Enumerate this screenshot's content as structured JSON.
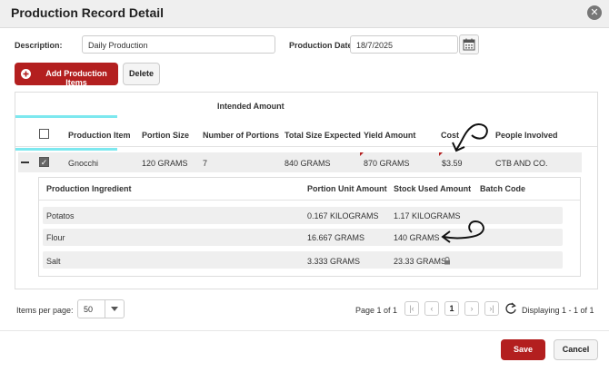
{
  "dialog": {
    "title": "Production Record Detail"
  },
  "form": {
    "description_label": "Description:",
    "description_value": "Daily Production",
    "date_label": "Production Date:",
    "date_value": "18/7/2025"
  },
  "toolbar": {
    "add_label": "Add Production Items",
    "delete_label": "Delete"
  },
  "grid": {
    "group_header": "Intended Amount",
    "columns": [
      "Production Item",
      "Portion Size",
      "Number of Portions",
      "Total Size Expected",
      "Yield Amount",
      "Cost",
      "People Involved"
    ],
    "row": {
      "item": "Gnocchi",
      "portion_size": "120 GRAMS",
      "portions": "7",
      "total_expected": "840 GRAMS",
      "yield": "870 GRAMS",
      "cost": "$3.59",
      "people": "CTB AND CO."
    },
    "sub_columns": [
      "Production Ingredient",
      "Portion Unit Amount",
      "Stock Used Amount",
      "Batch Code"
    ],
    "sub_rows": [
      {
        "ingredient": "Potatos",
        "unit_amount": "0.167 KILOGRAMS",
        "stock_used": "1.17 KILOGRAMS"
      },
      {
        "ingredient": "Flour",
        "unit_amount": "16.667 GRAMS",
        "stock_used": "140 GRAMS"
      },
      {
        "ingredient": "Salt",
        "unit_amount": "3.333 GRAMS",
        "stock_used": "23.33 GRAMS"
      }
    ]
  },
  "pager": {
    "items_label": "Items per page:",
    "page_size": "50",
    "page_info": "Page 1 of 1",
    "current_page": "1",
    "display_info": "Displaying 1 - 1 of 1"
  },
  "footer": {
    "save_label": "Save",
    "cancel_label": "Cancel"
  },
  "colors": {
    "accent": "#b31f1f",
    "highlight": "#7de8ef",
    "row_bg": "#eeeeee"
  },
  "icons": [
    "close-icon",
    "calendar-icon",
    "plus-circle-icon",
    "checkbox-icon",
    "minus-icon",
    "chevron-down-icon",
    "lock-icon",
    "first-page-icon",
    "prev-page-icon",
    "next-page-icon",
    "last-page-icon",
    "refresh-icon",
    "arrow-annotation-icon"
  ]
}
